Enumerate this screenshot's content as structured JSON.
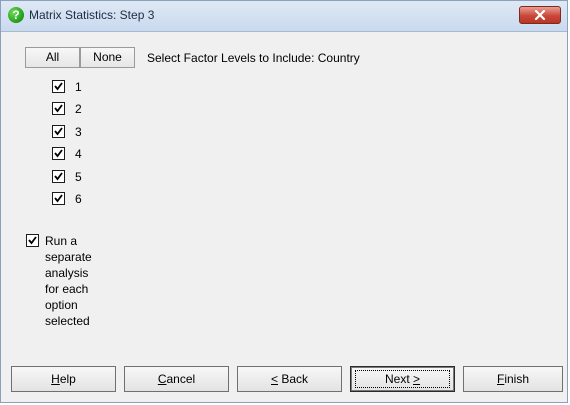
{
  "window": {
    "title": "Matrix Statistics: Step 3",
    "icon": "help-question-icon",
    "close_icon": "close-icon"
  },
  "selector": {
    "all_label": "All",
    "none_label": "None",
    "prompt": "Select Factor Levels to Include: Country"
  },
  "levels": [
    {
      "label": "1",
      "checked": true
    },
    {
      "label": "2",
      "checked": true
    },
    {
      "label": "3",
      "checked": true
    },
    {
      "label": "4",
      "checked": true
    },
    {
      "label": "5",
      "checked": true
    },
    {
      "label": "6",
      "checked": true
    }
  ],
  "separate_analysis": {
    "label": "Run a separate analysis for each option selected",
    "checked": true
  },
  "buttons": {
    "help": {
      "mnemonic": "H",
      "rest": "elp"
    },
    "cancel": {
      "mnemonic": "C",
      "rest": "ancel"
    },
    "back": {
      "mnemonic": "<",
      "rest": " Back"
    },
    "next": {
      "text": "Next ",
      "mnemonic": ">"
    },
    "finish": {
      "mnemonic": "F",
      "rest": "inish"
    }
  },
  "colors": {
    "window_bg": "#f0f0f0",
    "title_bar": "#c9d9ee",
    "close_button": "#c9483a"
  }
}
